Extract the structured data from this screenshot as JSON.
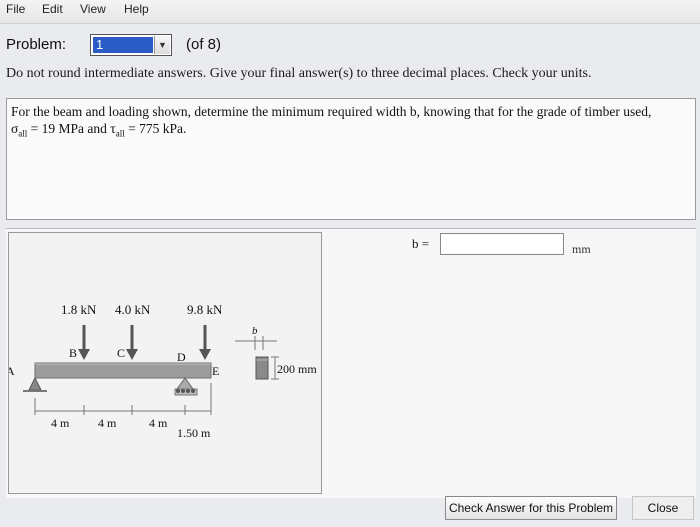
{
  "menu": {
    "file": "File",
    "edit": "Edit",
    "view": "View",
    "help": "Help"
  },
  "problem": {
    "label": "Problem:",
    "selected": "1",
    "of_total": "(of 8)"
  },
  "instructions": "Do not round intermediate answers. Give your final answer(s) to three decimal places. Check your units.",
  "question": {
    "line1": "For the beam and loading shown, determine the minimum required width b, knowing that for the grade of timber used,",
    "sigma_symbol": "σ",
    "sigma_sub": "all",
    "sigma_value": " = 19 MPa and ",
    "tau_symbol": "τ",
    "tau_sub": "all",
    "tau_value": " = 775 kPa."
  },
  "figure": {
    "loads": [
      "1.8 kN",
      "4.0 kN",
      "9.8 kN"
    ],
    "points": [
      "A",
      "B",
      "C",
      "D",
      "E"
    ],
    "spans": [
      "4 m",
      "4 m",
      "4 m",
      "1.50 m"
    ],
    "section_width_label": "b",
    "section_height_label": "200 mm"
  },
  "answer": {
    "label": "b =",
    "value": "",
    "unit": "mm"
  },
  "buttons": {
    "check": "Check Answer for this Problem",
    "close": "Close"
  },
  "colors": {
    "select_highlight": "#2b5cc5",
    "beam": "#9c9c9c",
    "load_arrow": "#555555"
  }
}
